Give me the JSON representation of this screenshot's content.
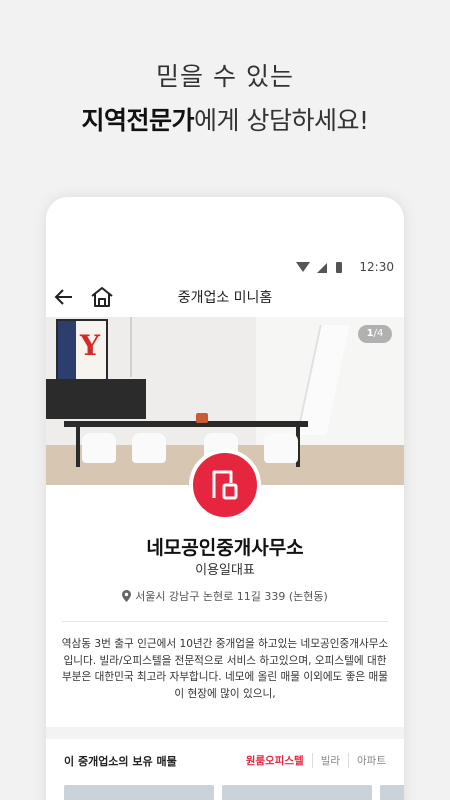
{
  "headline": {
    "line1": "믿을 수 있는",
    "line2_bold": "지역전문가",
    "line2_rest": "에게 상담하세요!"
  },
  "statusbar": {
    "time": "12:30"
  },
  "appbar": {
    "title": "중개업소 미니홈"
  },
  "hero": {
    "counter_current": "1",
    "counter_total": "/4"
  },
  "office": {
    "name": "네모공인중개사무소",
    "representative": "이용일대표",
    "address": "서울시 강남구 논현로 11길 339 (논현동)"
  },
  "description": "역삼동 3번 출구 인근에서 10년간 중개업을 하고있는 네모공인중개사무소입니다. 빌라/오피스텔을 전문적으로 서비스 하고있으며, 오피스텔에 대한 부분은 대한민국 최고라 자부합니다. 네모에 올린 매물 이외에도 좋은 매물이 현장에 많이 있으니,",
  "listings": {
    "label": "이 중개업소의 보유 매물",
    "tabs": [
      "원룸오피스텔",
      "빌라",
      "아파트"
    ]
  },
  "colors": {
    "accent": "#e6263e"
  }
}
